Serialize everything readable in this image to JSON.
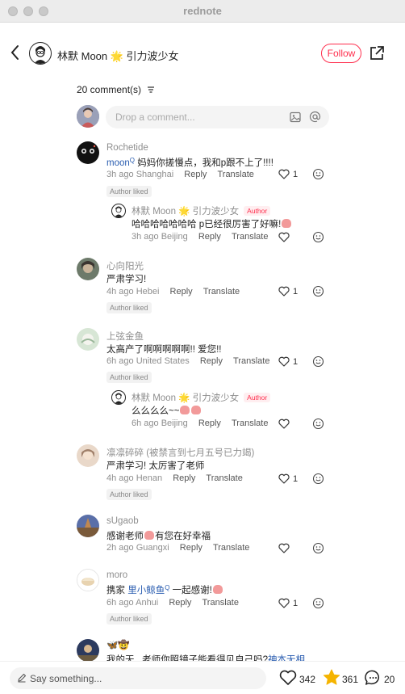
{
  "window": {
    "title": "rednote"
  },
  "header": {
    "author_name": "林默 Moon 🌟 引力波少女",
    "follow_label": "Follow"
  },
  "comments_count": "20 comment(s)",
  "input": {
    "placeholder": "Drop a comment..."
  },
  "comments": [
    {
      "user": "Rochetide",
      "mention": "moon",
      "text": "妈妈你搓慢点，我和p跟不上了!!!!",
      "time": "3h ago",
      "location": "Shanghai",
      "reply_label": "Reply",
      "translate_label": "Translate",
      "likes": "1",
      "badge": "Author liked"
    },
    {
      "user": "心向阳光",
      "text": "严肃学习!",
      "time": "4h ago",
      "location": "Hebei",
      "reply_label": "Reply",
      "translate_label": "Translate",
      "likes": "1",
      "badge": "Author liked"
    },
    {
      "user": "上弦金鱼",
      "text": "太高产了啊啊啊啊啊!! 爱您!!",
      "time": "6h ago",
      "location": "United States",
      "reply_label": "Reply",
      "translate_label": "Translate",
      "likes": "1",
      "badge": "Author liked"
    },
    {
      "user": "凛凛碎碎 (被禁言到七月五号已力竭)",
      "text": "严肃学习! 太厉害了老师",
      "time": "4h ago",
      "location": "Henan",
      "reply_label": "Reply",
      "translate_label": "Translate",
      "likes": "1",
      "badge": "Author liked"
    },
    {
      "user": "sUgaob",
      "text_a": "感谢老师",
      "text_b": "有您在好幸福",
      "time": "2h ago",
      "location": "Guangxi",
      "reply_label": "Reply",
      "translate_label": "Translate"
    },
    {
      "user": "moro",
      "text_a": "携家 ",
      "mention": "里小鲸鱼",
      "text_b": " 一起感谢!",
      "time": "6h ago",
      "location": "Anhui",
      "reply_label": "Reply",
      "translate_label": "Translate",
      "likes": "1",
      "badge": "Author liked"
    },
    {
      "user": "🦋🤠",
      "text_a": "我的天...老师你照镜子能看得见自己吗?",
      "mention": "神本无相",
      "text_b": "..."
    }
  ],
  "replies": [
    {
      "user": "林默 Moon 🌟 引力波少女",
      "tag": "Author",
      "text": "哈哈哈哈哈哈哈 p已经很厉害了好嘛!",
      "time": "3h ago",
      "location": "Beijing",
      "reply_label": "Reply",
      "translate_label": "Translate"
    },
    {
      "user": "林默 Moon 🌟 引力波少女",
      "tag": "Author",
      "text": "么么么么~~",
      "time": "6h ago",
      "location": "Beijing",
      "reply_label": "Reply",
      "translate_label": "Translate"
    }
  ],
  "bottom": {
    "placeholder": "Say something...",
    "likes": "342",
    "favorites": "361",
    "comments": "20"
  },
  "colors": {
    "accent": "#ff2e4d",
    "mention": "#2a5db0",
    "star": "#f5b400"
  },
  "icons": [
    "back-icon",
    "share-icon",
    "sort-icon",
    "image-icon",
    "at-icon",
    "heart-icon",
    "emoji-icon",
    "pencil-icon",
    "star-icon",
    "comment-icon"
  ]
}
